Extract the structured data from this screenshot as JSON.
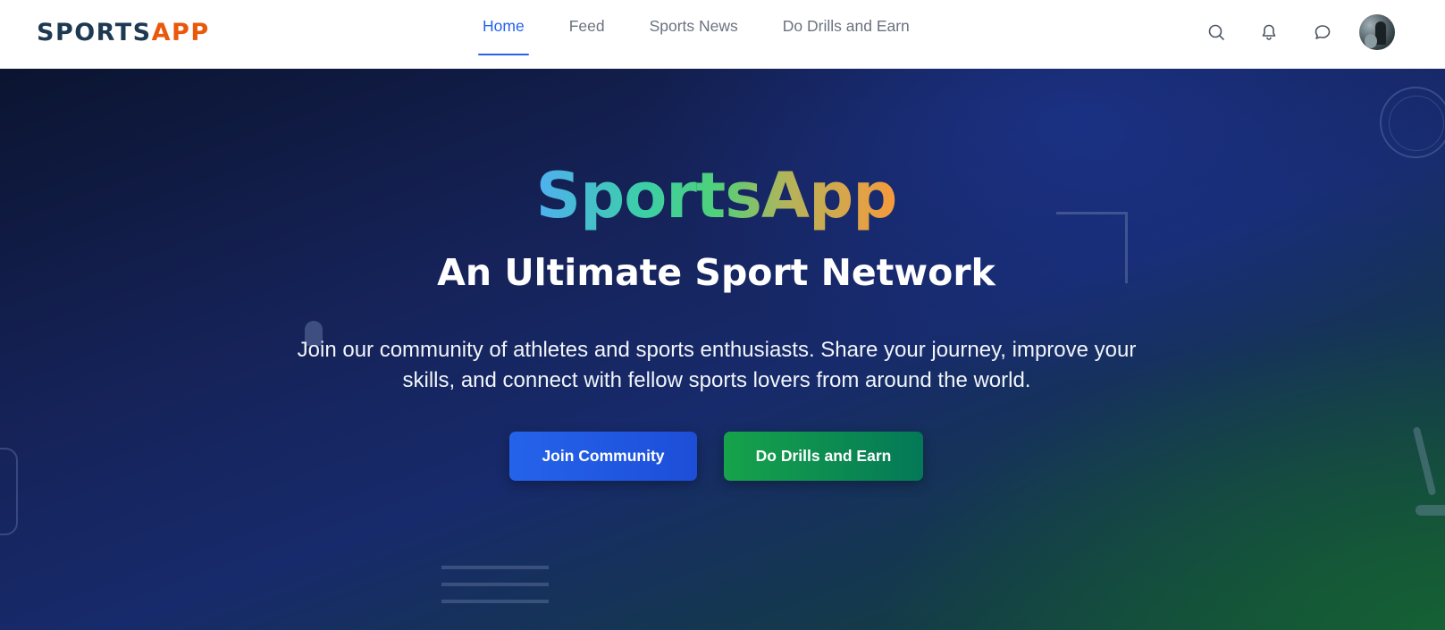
{
  "navbar": {
    "logo_part1": "SPORTS",
    "logo_part2": "APP",
    "tabs": [
      {
        "label": "Home",
        "active": true
      },
      {
        "label": "Feed",
        "active": false
      },
      {
        "label": "Sports News",
        "active": false
      },
      {
        "label": "Do Drills and Earn",
        "active": false
      }
    ],
    "icons": [
      "search-icon",
      "bell-icon",
      "chat-icon",
      "avatar"
    ]
  },
  "hero": {
    "title": "SportsApp",
    "subtitle": "An Ultimate Sport Network",
    "description": "Join our community of athletes and sports enthusiasts. Share your journey, improve your skills, and connect with fellow sports lovers from around the world.",
    "primary_button": "Join Community",
    "secondary_button": "Do Drills and Earn"
  },
  "colors": {
    "accent_blue": "#2563eb",
    "accent_orange": "#ea580c",
    "logo_dark": "#1e3a52",
    "button_green": "#16a34a"
  }
}
